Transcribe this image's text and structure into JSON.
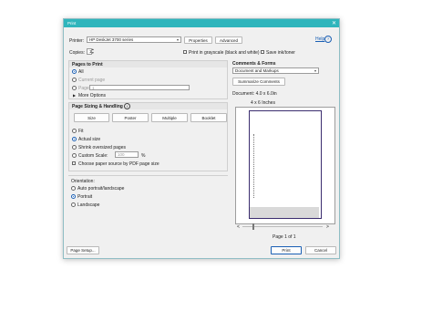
{
  "window": {
    "title": "Print",
    "close_glyph": "✕"
  },
  "printer": {
    "label": "Printer:",
    "selected": "HP DeskJet 3700 series",
    "properties_label": "Properties",
    "advanced_label": "Advanced",
    "help_label": "Help",
    "help_icon": "?"
  },
  "copies": {
    "label": "Copies:",
    "value": "1",
    "grayscale_label": "Print in grayscale (black and white)",
    "save_ink_label": "Save ink/toner"
  },
  "pages_to_print": {
    "title": "Pages to Print",
    "all_label": "All",
    "current_label": "Current page",
    "pages_label": "Pages",
    "pages_value": "1",
    "more_options_label": "More Options"
  },
  "sizing": {
    "title": "Page Sizing & Handling",
    "info_icon": "i",
    "buttons": [
      "Size",
      "Poster",
      "Multiple",
      "Booklet"
    ],
    "fit_label": "Fit",
    "actual_label": "Actual size",
    "shrink_label": "Shrink oversized pages",
    "custom_label": "Custom Scale:",
    "custom_value": "100",
    "percent": "%",
    "paper_source_label": "Choose paper source by PDF page size"
  },
  "orientation": {
    "title": "Orientation:",
    "auto_label": "Auto portrait/landscape",
    "portrait_label": "Portrait",
    "landscape_label": "Landscape"
  },
  "comments": {
    "title": "Comments & Forms",
    "selected": "Document and Markups",
    "summarize_label": "Summarize Comments"
  },
  "preview": {
    "document_label": "Document: 4.0 x 6.0in",
    "size_label": "4 x 6 Inches",
    "page_indicator": "Page 1 of 1",
    "prev_glyph": "<",
    "next_glyph": ">"
  },
  "footer": {
    "page_setup_label": "Page Setup...",
    "print_label": "Print",
    "cancel_label": "Cancel"
  },
  "colors": {
    "accent": "#2fb5bc",
    "selection": "#1a5fb4"
  }
}
